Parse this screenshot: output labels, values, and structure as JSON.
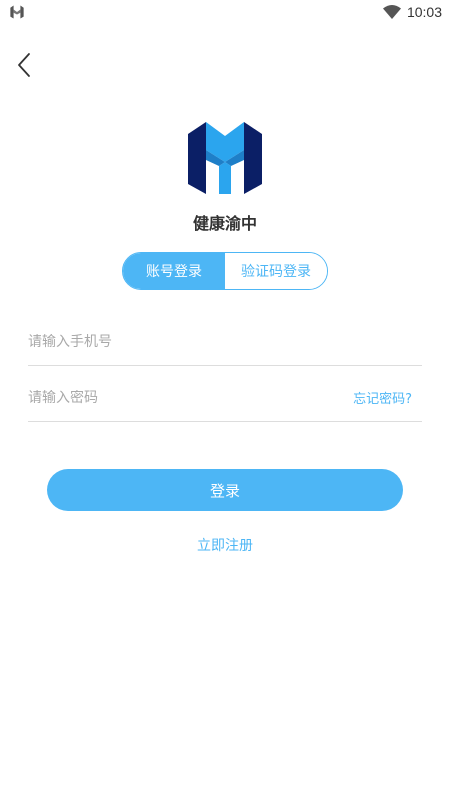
{
  "status_bar": {
    "time": "10:03",
    "icons": [
      "app-logo-icon",
      "wifi-icon"
    ]
  },
  "header": {
    "back_icon": "chevron-left-icon"
  },
  "app": {
    "name": "健康渝中",
    "logo_icon": "app-logo-icon",
    "colors": {
      "logo_light": "#2BA5EE",
      "logo_dark": "#0B1F66"
    }
  },
  "tabs": [
    {
      "label": "账号登录",
      "active": true
    },
    {
      "label": "验证码登录",
      "active": false
    }
  ],
  "form": {
    "phone_placeholder": "请输入手机号",
    "password_placeholder": "请输入密码",
    "forgot_password": "忘记密码?"
  },
  "actions": {
    "login": "登录",
    "register": "立即注册"
  },
  "colors": {
    "accent": "#4DB6F5",
    "placeholder": "#A9A9A9",
    "divider": "#DDDDDD"
  }
}
